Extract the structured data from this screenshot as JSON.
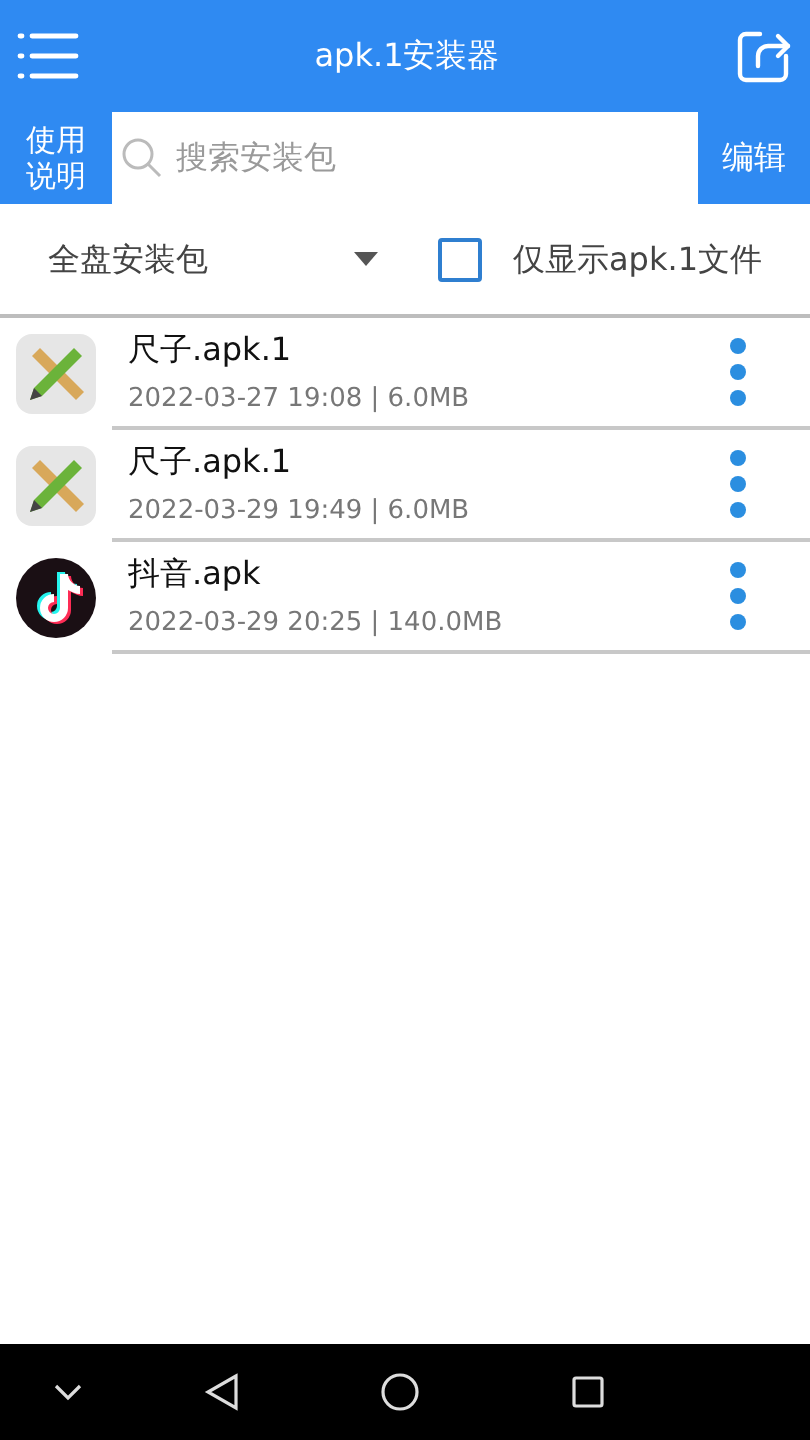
{
  "header": {
    "title": "apk.1安装器"
  },
  "search": {
    "help_label": "使用说明",
    "placeholder": "搜索安装包",
    "edit_label": "编辑"
  },
  "filter": {
    "scope": "全盘安装包",
    "only_apk1_label": "仅显示apk.1文件",
    "only_apk1_checked": false
  },
  "files": [
    {
      "name": "尺子.apk.1",
      "meta": "2022-03-27 19:08 | 6.0MB",
      "kind": "ruler"
    },
    {
      "name": "尺子.apk.1",
      "meta": "2022-03-29 19:49 | 6.0MB",
      "kind": "ruler"
    },
    {
      "name": "抖音.apk",
      "meta": "2022-03-29 20:25 | 140.0MB",
      "kind": "note"
    }
  ]
}
